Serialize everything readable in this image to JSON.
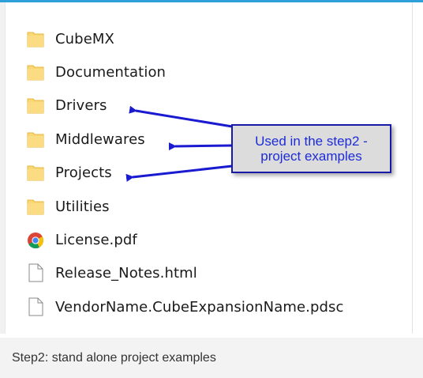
{
  "items": [
    {
      "label": "CubeMX",
      "icon": "folder-icon"
    },
    {
      "label": "Documentation",
      "icon": "folder-icon"
    },
    {
      "label": "Drivers",
      "icon": "folder-icon"
    },
    {
      "label": "Middlewares",
      "icon": "folder-icon"
    },
    {
      "label": "Projects",
      "icon": "folder-icon"
    },
    {
      "label": "Utilities",
      "icon": "folder-icon"
    },
    {
      "label": "License.pdf",
      "icon": "chrome-icon"
    },
    {
      "label": "Release_Notes.html",
      "icon": "file-icon"
    },
    {
      "label": "VendorName.CubeExpansionName.pdsc",
      "icon": "file-icon"
    }
  ],
  "callout": {
    "line1": "Used in the step2 -",
    "line2": "project examples"
  },
  "caption": "Step2: stand alone project examples",
  "colors": {
    "folder": "#f8d775",
    "folder_dark": "#e6b740",
    "arrow": "#1a1ad0",
    "accent_bar": "#2e9fd8"
  }
}
